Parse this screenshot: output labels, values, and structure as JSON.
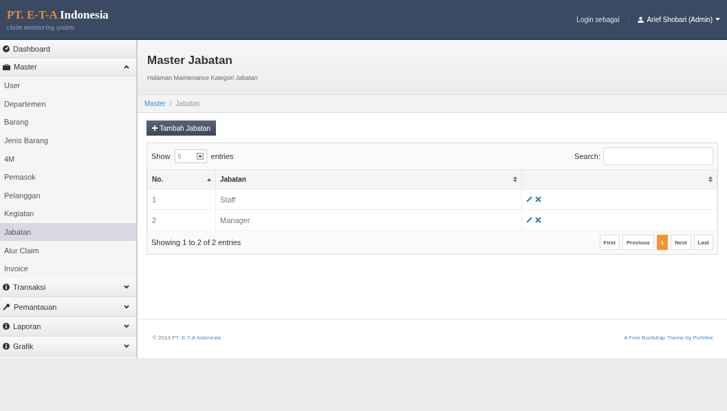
{
  "brand": {
    "accent": "PT. E-T-A",
    "rest": "Indonesia",
    "tagline": "claim monitoring system"
  },
  "user_bar": {
    "label": "Login sebagai",
    "separator": ":",
    "user": "Arief Shobari (Admin)"
  },
  "sidebar": [
    {
      "kind": "link",
      "label": "Dashboard"
    },
    {
      "kind": "group",
      "label": "Master",
      "expanded": true,
      "children": [
        {
          "label": "User",
          "selected": false
        },
        {
          "label": "Departemen",
          "selected": false
        },
        {
          "label": "Barang",
          "selected": false
        },
        {
          "label": "Jenis Barang",
          "selected": false
        },
        {
          "label": "4M",
          "selected": false
        },
        {
          "label": "Pemasok",
          "selected": false
        },
        {
          "label": "Pelanggan",
          "selected": false
        },
        {
          "label": "Kegiatan",
          "selected": false
        },
        {
          "label": "Jabatan",
          "selected": true
        },
        {
          "label": "Alur Claim",
          "selected": false
        },
        {
          "label": "Invoice",
          "selected": false
        }
      ]
    },
    {
      "kind": "group",
      "label": "Transaksi",
      "expanded": false
    },
    {
      "kind": "group",
      "label": "Pemantauan",
      "expanded": false
    },
    {
      "kind": "group",
      "label": "Laporan",
      "expanded": false
    },
    {
      "kind": "group",
      "label": "Grafik",
      "expanded": false
    }
  ],
  "header": {
    "title": "Master Jabatan",
    "subtitle": "Halaman Maintenance Kategori Jabatan"
  },
  "breadcrumb_separator": "/",
  "breadcrumb": [
    {
      "label": "Master",
      "selected": false
    },
    {
      "label": "Jabatan",
      "selected": true
    }
  ],
  "add_button": "Tambah Jabatan",
  "table": {
    "length_prefix": "Show",
    "length_value": "5",
    "length_suffix": "entries",
    "search_label": "Search:",
    "columns": [
      {
        "label": "No.",
        "sorted": true
      },
      {
        "label": "Jabatan",
        "sorted": false
      }
    ],
    "rows": [
      {
        "no": "1",
        "jabatan": "Staff"
      },
      {
        "no": "2",
        "jabatan": "Manager"
      }
    ],
    "info": "Showing 1 to 2 of 2 entries",
    "pagination": [
      {
        "label": "First",
        "selected": false
      },
      {
        "label": "Previous",
        "selected": false
      },
      {
        "label": "1",
        "selected": true
      },
      {
        "label": "Next",
        "selected": false
      },
      {
        "label": "Last",
        "selected": false
      }
    ]
  },
  "footer": {
    "copyright": "© 2013",
    "company": "PT. E-T-A Indonesia",
    "theme_link": "A Free Bootstrap Theme",
    "by": "by",
    "author": "Portnine"
  }
}
